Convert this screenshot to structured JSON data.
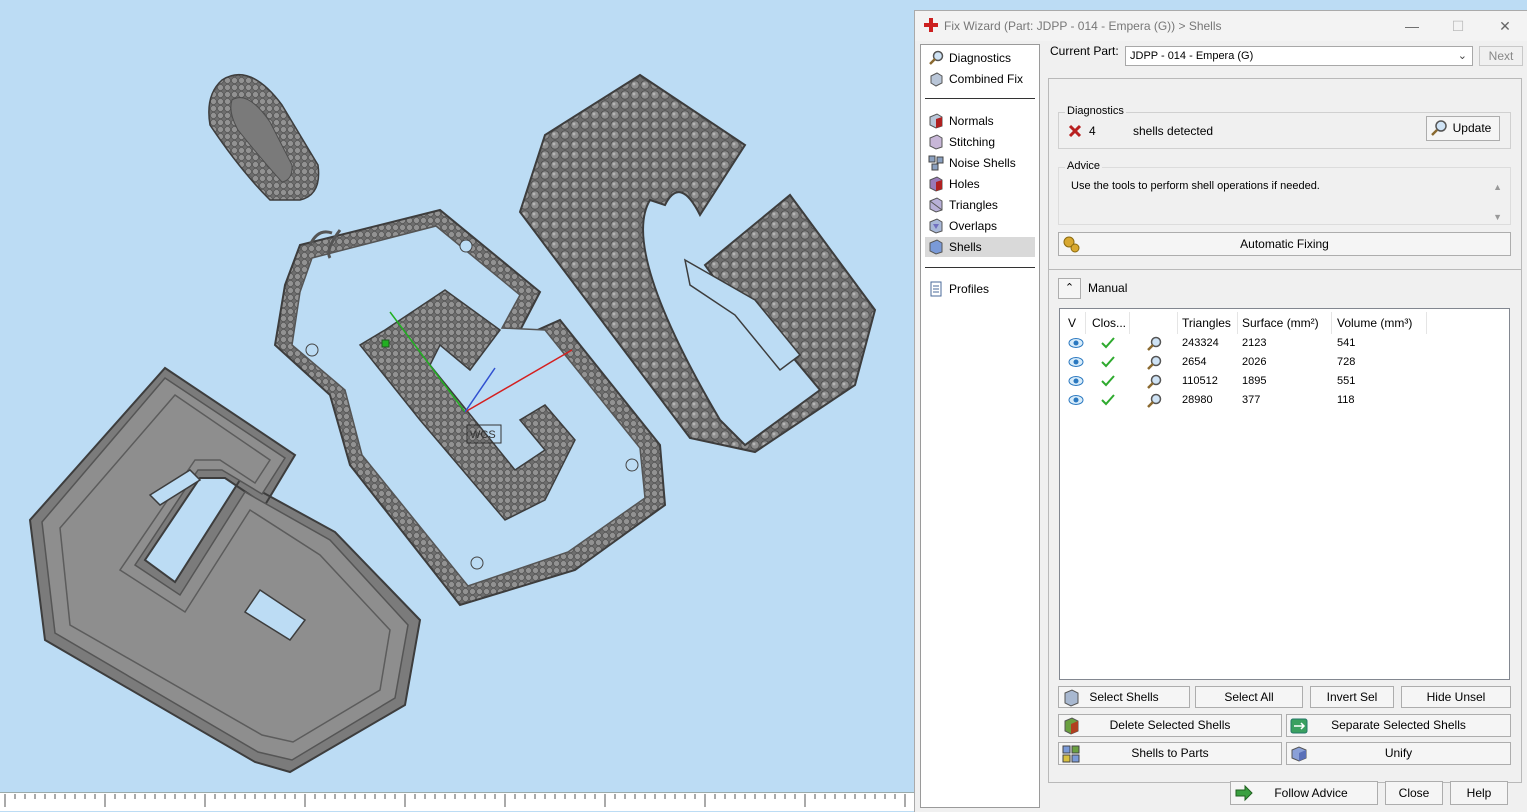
{
  "window": {
    "title": "Fix Wizard (Part: JDPP - 014 - Empera (G)) > Shells",
    "minimize": "—",
    "maximize": "☐",
    "close": "✕"
  },
  "nav": {
    "items": [
      {
        "label": "Diagnostics",
        "icon": "magnifier-icon"
      },
      {
        "label": "Combined Fix",
        "icon": "cube-icon"
      },
      {
        "label": "Normals",
        "icon": "normals-icon"
      },
      {
        "label": "Stitching",
        "icon": "stitching-icon"
      },
      {
        "label": "Noise Shells",
        "icon": "noise-shells-icon"
      },
      {
        "label": "Holes",
        "icon": "holes-icon"
      },
      {
        "label": "Triangles",
        "icon": "triangles-icon"
      },
      {
        "label": "Overlaps",
        "icon": "overlaps-icon"
      },
      {
        "label": "Shells",
        "icon": "shells-icon"
      },
      {
        "label": "Profiles",
        "icon": "profiles-icon"
      }
    ],
    "active": "Shells"
  },
  "current_part": {
    "label": "Current Part:",
    "value": "JDPP - 014 - Empera (G)",
    "next": "Next"
  },
  "diagnostics": {
    "title": "Diagnostics",
    "count": "4",
    "message": "shells detected",
    "update": "Update"
  },
  "advice": {
    "title": "Advice",
    "text": "Use the tools to perform shell operations if needed.",
    "automatic_fixing": "Automatic Fixing"
  },
  "manual": {
    "title": "Manual",
    "columns": [
      "V",
      "Clos...",
      "",
      "Triangles",
      "Surface (mm²)",
      "Volume (mm³)"
    ],
    "rows": [
      {
        "triangles": "243324",
        "surface": "2123",
        "volume": "541"
      },
      {
        "triangles": "2654",
        "surface": "2026",
        "volume": "728"
      },
      {
        "triangles": "110512",
        "surface": "1895",
        "volume": "551"
      },
      {
        "triangles": "28980",
        "surface": "377",
        "volume": "118"
      }
    ],
    "buttons": {
      "select_shells": "Select Shells",
      "select_all": "Select All",
      "invert_sel": "Invert Sel",
      "hide_unsel": "Hide Unsel",
      "delete_selected": "Delete Selected Shells",
      "separate_selected": "Separate Selected Shells",
      "shells_to_parts": "Shells to Parts",
      "unify": "Unify"
    }
  },
  "footer": {
    "follow_advice": "Follow Advice",
    "close": "Close",
    "help": "Help"
  },
  "viewport": {
    "wcs_label": "WCS",
    "background": "#bcdcf4",
    "axis_colors": {
      "x": "#d42020",
      "y": "#22b022",
      "z": "#3050d0"
    }
  },
  "colors": {
    "accent_red": "#cc2020",
    "check_green": "#2eaa2e",
    "eye_blue": "#2a78c0"
  }
}
